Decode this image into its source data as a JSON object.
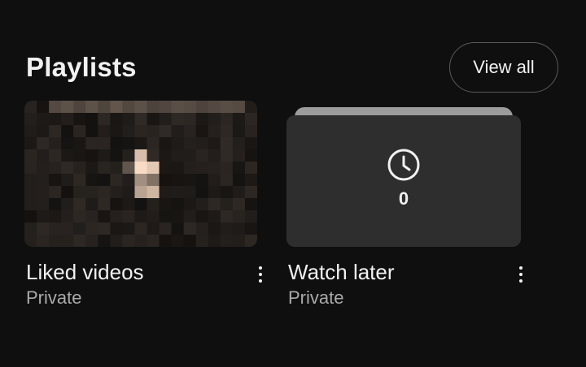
{
  "section": {
    "title": "Playlists",
    "view_all_label": "View all"
  },
  "playlists": [
    {
      "title": "Liked videos",
      "privacy": "Private",
      "thumbnail": "pixelated-video-frame",
      "menu_icon": "more-vert-icon"
    },
    {
      "title": "Watch later",
      "privacy": "Private",
      "video_count": "0",
      "thumbnail_icon": "clock-icon",
      "menu_icon": "more-vert-icon"
    }
  ],
  "colors": {
    "background": "#0f0f0f",
    "text_primary": "#f1f1f1",
    "text_secondary": "#aaaaaa",
    "card_surface": "#2e2e2e",
    "button_border": "#5a5a5a"
  }
}
